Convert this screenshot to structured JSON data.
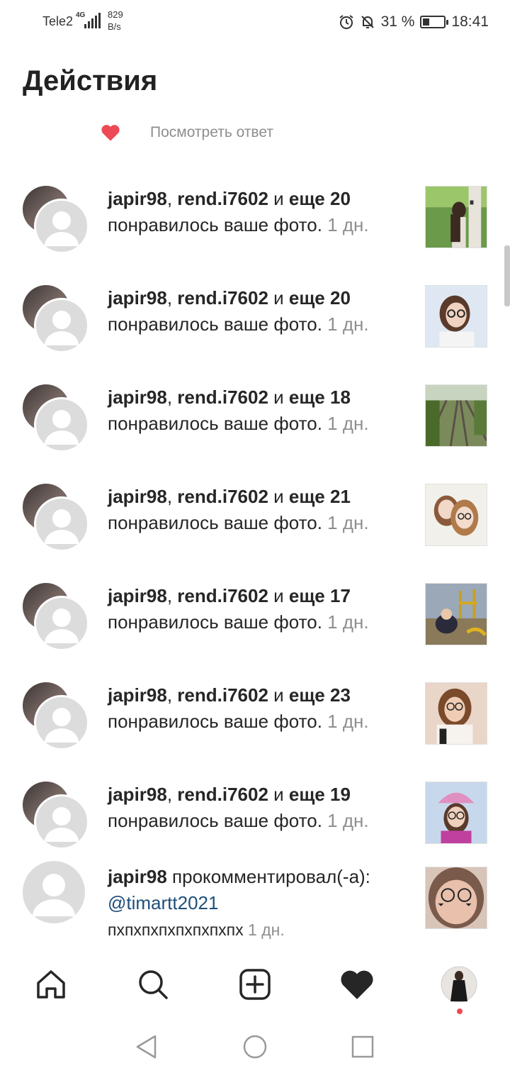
{
  "status_bar": {
    "carrier": "Tele2",
    "network": "4G",
    "speed_value": "829",
    "speed_unit": "B/s",
    "battery": "31 %",
    "battery_level": 0.31,
    "time": "18:41"
  },
  "page_title": "Действия",
  "view_reply": "Посмотреть ответ",
  "rows": [
    {
      "user1": "japir98",
      "sep": ", ",
      "user2": "rend.i7602",
      "and": " и ",
      "more": "еще 20",
      "action": "понравилось ваше фото.",
      "time": " 1 дн."
    },
    {
      "user1": "japir98",
      "sep": ", ",
      "user2": "rend.i7602",
      "and": " и ",
      "more": "еще 20",
      "action": "понравилось ваше фото.",
      "time": " 1 дн."
    },
    {
      "user1": "japir98",
      "sep": ", ",
      "user2": "rend.i7602",
      "and": " и ",
      "more": "еще 18",
      "action": "понравилось ваше фото.",
      "time": " 1 дн."
    },
    {
      "user1": "japir98",
      "sep": ", ",
      "user2": "rend.i7602",
      "and": " и ",
      "more": "еще 21",
      "action": "понравилось ваше фото.",
      "time": " 1 дн."
    },
    {
      "user1": "japir98",
      "sep": ", ",
      "user2": "rend.i7602",
      "and": " и ",
      "more": "еще 17",
      "action": "понравилось ваше фото.",
      "time": " 1 дн."
    },
    {
      "user1": "japir98",
      "sep": ", ",
      "user2": "rend.i7602",
      "and": " и ",
      "more": "еще 23",
      "action": "понравилось ваше фото.",
      "time": " 1 дн."
    },
    {
      "user1": "japir98",
      "sep": ", ",
      "user2": "rend.i7602",
      "and": " и ",
      "more": "еще 19",
      "action": "понравилось ваше фото.",
      "time": " 1 дн."
    }
  ],
  "comment_row": {
    "user": "japir98",
    "action": " прокомментировал(-а):",
    "mention": "@timartt2021",
    "comment": "пхпхпхпхпхпхпхпх",
    "time": " 1 дн."
  },
  "bottom_nav": {
    "icons": [
      "home-icon",
      "search-icon",
      "add-post-icon",
      "activity-heart-icon",
      "profile-avatar"
    ]
  },
  "colors": {
    "heart": "#ed4956",
    "mention": "#1f4f7a",
    "muted": "#8e8e8e"
  }
}
